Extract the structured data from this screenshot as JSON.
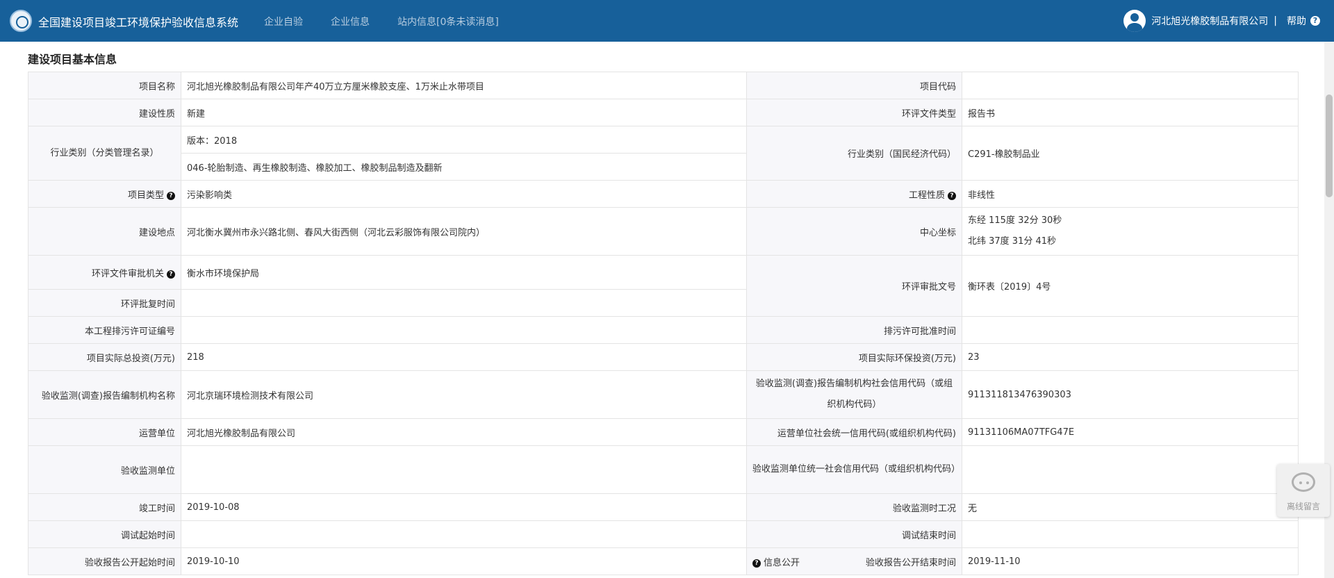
{
  "header": {
    "app_title": "全国建设项目竣工环境保护验收信息系统",
    "nav": [
      "企业自验",
      "企业信息",
      "站内信息[0条未读消息]"
    ],
    "user": "河北旭光橡胶制品有限公司",
    "separator": "|",
    "help": "帮助",
    "help_icon_glyph": "?"
  },
  "section_title": "建设项目基本信息",
  "q_glyph": "?",
  "rows": {
    "project_name": {
      "label": "项目名称",
      "value": "河北旭光橡胶制品有限公司年产40万立方厘米橡胶支座、1万米止水带项目"
    },
    "project_code": {
      "label": "项目代码",
      "value": ""
    },
    "construction_nature": {
      "label": "建设性质",
      "value": "新建"
    },
    "eia_doc_type": {
      "label": "环评文件类型",
      "value": "报告书"
    },
    "industry_mgmt": {
      "label": "行业类别（分类管理名录）",
      "version": "版本：2018",
      "value": "046-轮胎制造、再生橡胶制造、橡胶加工、橡胶制品制造及翻新"
    },
    "industry_econ": {
      "label": "行业类别（国民经济代码）",
      "value": "C291-橡胶制品业"
    },
    "project_type": {
      "label": "项目类型",
      "value": "污染影响类"
    },
    "engineering_nature": {
      "label": "工程性质",
      "value": "非线性"
    },
    "location": {
      "label": "建设地点",
      "value": "河北衡水冀州市永兴路北侧、春风大街西侧（河北云彩服饰有限公司院内）"
    },
    "center_coord": {
      "label": "中心坐标",
      "lon": "东经 115度 32分 30秒",
      "lat": "北纬 37度 31分 41秒"
    },
    "eia_approval_org": {
      "label": "环评文件审批机关",
      "value": "衡水市环境保护局"
    },
    "eia_approval_no": {
      "label": "环评审批文号",
      "value": "衡环表〔2019〕4号"
    },
    "eia_reply_time": {
      "label": "环评批复时间",
      "value": ""
    },
    "permit_no": {
      "label": "本工程排污许可证编号",
      "value": ""
    },
    "permit_time": {
      "label": "排污许可批准时间",
      "value": ""
    },
    "total_invest": {
      "label": "项目实际总投资(万元)",
      "value": "218"
    },
    "env_invest": {
      "label": "项目实际环保投资(万元)",
      "value": "23"
    },
    "report_org": {
      "label": "验收监测(调查)报告编制机构名称",
      "value": "河北京瑞环境检测技术有限公司"
    },
    "report_org_code": {
      "label": "验收监测(调查)报告编制机构社会信用代码（或组织机构代码）",
      "value": "911311813476390303"
    },
    "operator": {
      "label": "运营单位",
      "value": "河北旭光橡胶制品有限公司"
    },
    "operator_code": {
      "label": "运营单位社会统一信用代码(或组织机构代码)",
      "value": "91131106MA07TFG47E"
    },
    "monitor_org": {
      "label": "验收监测单位",
      "value": ""
    },
    "monitor_org_code": {
      "label": "验收监测单位统一社会信用代码（或组织机构代码）",
      "value": ""
    },
    "completion_time": {
      "label": "竣工时间",
      "value": "2019-10-08"
    },
    "monitor_condition": {
      "label": "验收监测时工况",
      "value": "无"
    },
    "debug_start": {
      "label": "调试起始时间",
      "value": ""
    },
    "debug_end": {
      "label": "调试结束时间",
      "value": ""
    },
    "publish_start": {
      "label": "验收报告公开起始时间",
      "value": "2019-10-10"
    },
    "info_public": {
      "label": "信息公开"
    },
    "publish_end": {
      "label": "验收报告公开结束时间",
      "value": "2019-11-10"
    }
  },
  "chat_widget": {
    "label": "离线留言"
  }
}
